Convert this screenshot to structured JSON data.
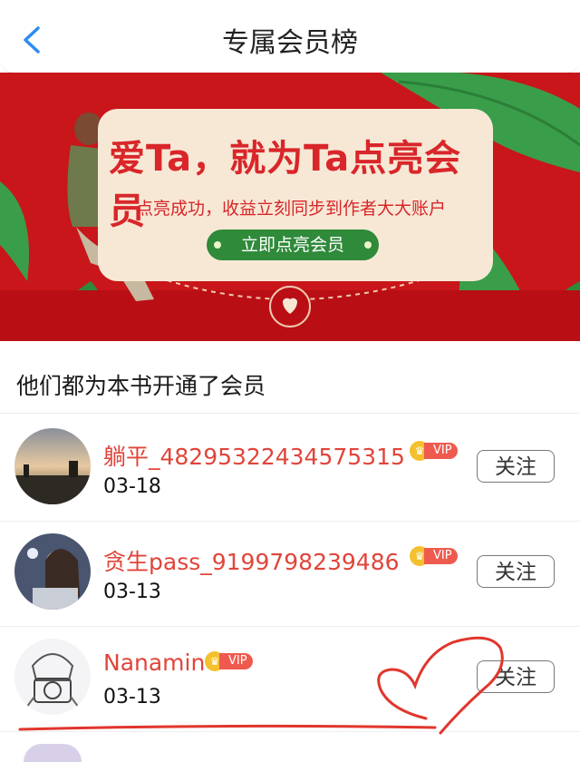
{
  "header": {
    "title": "专属会员榜",
    "back_icon": "chevron-left-icon"
  },
  "banner": {
    "headline": "爱Ta，就为Ta点亮会员",
    "subtitle": "点亮成功，收益立刻同步到作者大大账户",
    "cta": "立即点亮会员",
    "colors": {
      "background": "#c8161a",
      "card": "#f7e8d6",
      "button": "#2f8a3a",
      "text": "#d9262a"
    }
  },
  "section": {
    "title": "他们都为本书开通了会员"
  },
  "members": [
    {
      "name": "躺平_48295322434575315",
      "date": "03-18",
      "badge": "VIP",
      "follow": "关注"
    },
    {
      "name": "贪生pass_9199798239486",
      "date": "03-13",
      "badge": "VIP",
      "follow": "关注"
    },
    {
      "name": "Nanamin",
      "date": "03-13",
      "badge": "VIP",
      "follow": "关注"
    }
  ],
  "colors": {
    "name": "#e0453a",
    "vip": "#ef5a4f",
    "crown": "#f4c12e",
    "scribble": "#e0362c"
  }
}
